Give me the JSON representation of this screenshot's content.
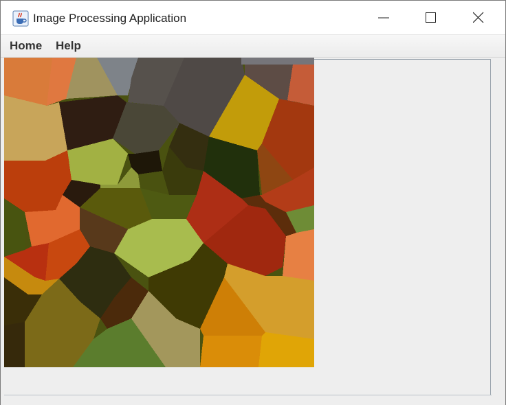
{
  "window": {
    "title": "Image Processing Application",
    "icon": "java-cup-icon",
    "controls": [
      "minimize-icon",
      "maximize-icon",
      "close-icon"
    ]
  },
  "menu": {
    "items": [
      {
        "label": "Home"
      },
      {
        "label": "Help"
      }
    ]
  },
  "colors": {
    "titlebar": "#ffffff",
    "menubar": "#f0f0f0",
    "background": "#eeeeee"
  }
}
